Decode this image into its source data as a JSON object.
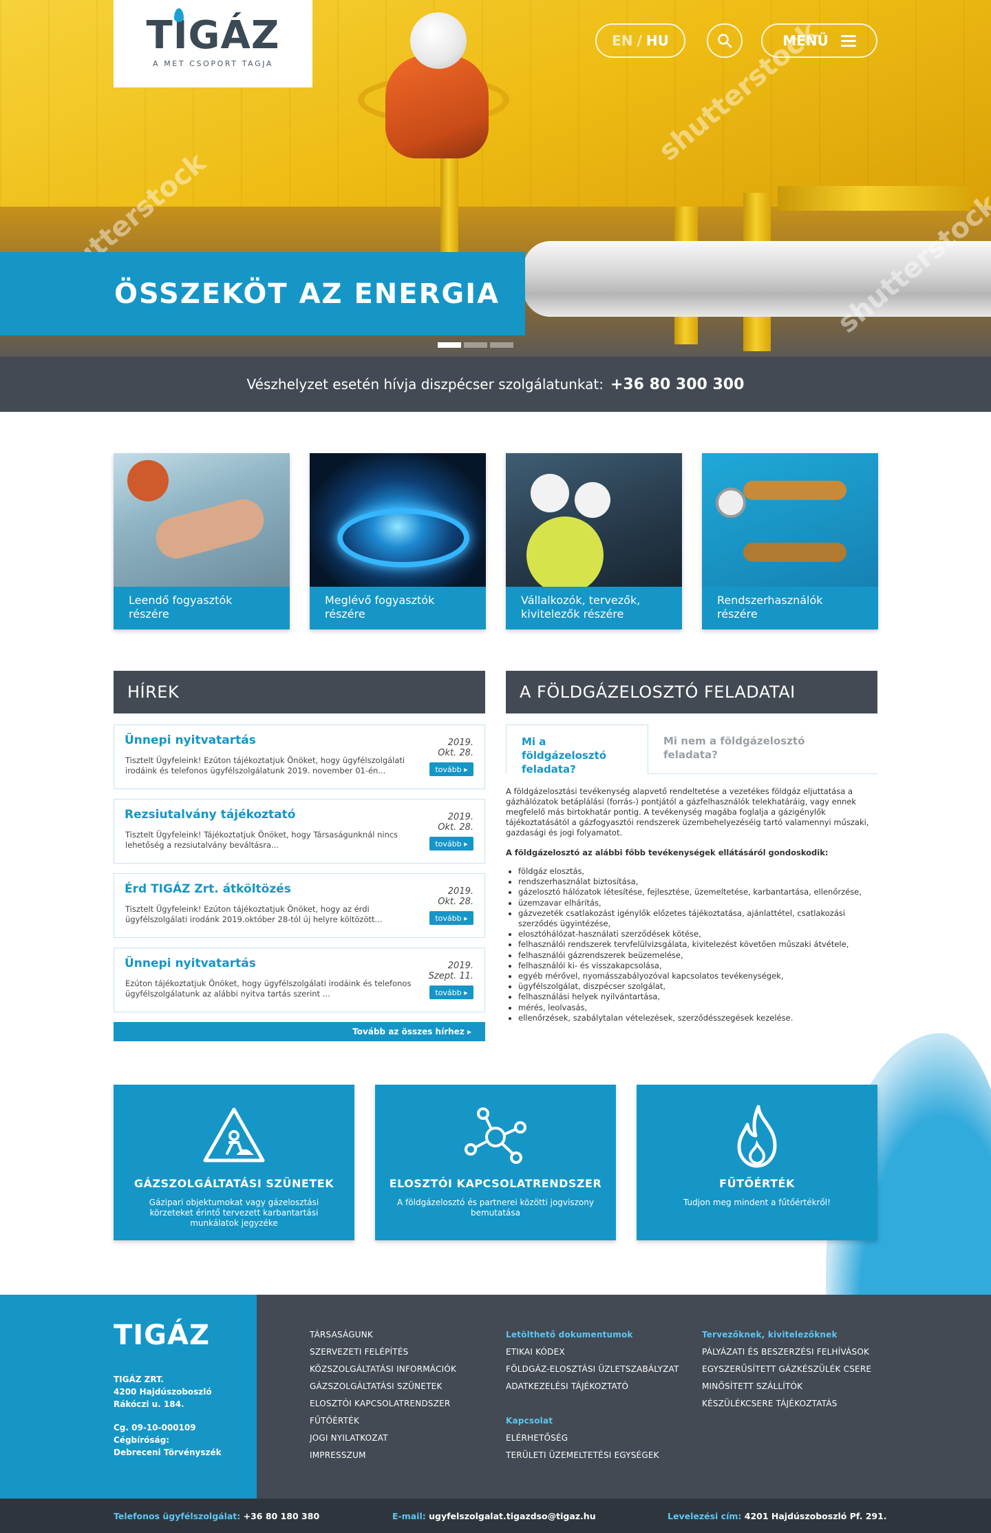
{
  "header": {
    "logo_text": "TIGÁZ",
    "logo_sub": "A MET CSOPORT TAGJA",
    "lang_en": "EN",
    "lang_sep": "/",
    "lang_hu": "HU",
    "menu_label": "MENÜ",
    "hero_title": "ÖSSZEKÖT AZ ENERGIA",
    "watermark": "shutterstock"
  },
  "emergency": {
    "text": "Vészhelyzet esetén hívja diszpécser szolgálatunkat:",
    "phone": "+36 80 300 300"
  },
  "cards": [
    {
      "label": "Leendő fogyasztók részére"
    },
    {
      "label": "Meglévő fogyasztók részére"
    },
    {
      "label": "Vállalkozók, tervezők, kivitelezők részére"
    },
    {
      "label": "Rendszerhasználók részére"
    }
  ],
  "news": {
    "heading": "HÍREK",
    "items": [
      {
        "title": "Ünnepi nyitvatartás",
        "text": "Tisztelt Ügyfeleink! Ezúton tájékoztatjuk Önöket, hogy ügyfélszolgálati irodáink és telefonos ügyfélszolgálatunk 2019. november 01-én...",
        "year": "2019.",
        "day": "Okt. 28.",
        "more": "tovább ▸"
      },
      {
        "title": "Rezsiutalvány tájékoztató",
        "text": "Tisztelt Ügyfeleink! Tájékoztatjuk Önöket, hogy Társaságunknál nincs lehetőség a rezsiutalvány beváltásra...",
        "year": "2019.",
        "day": "Okt. 28.",
        "more": "tovább ▸"
      },
      {
        "title": "Érd TIGÁZ Zrt. átköltözés",
        "text": "Tisztelt Ügyfeleink! Ezúton tájékoztatjuk Önöket, hogy az érdi ügyfélszolgálati irodánk 2019.október 28-tól új helyre költözött...",
        "year": "2019.",
        "day": "Okt. 28.",
        "more": "tovább ▸"
      },
      {
        "title": "Ünnepi nyitvatartás",
        "text": "Ezúton tájékoztatjuk Önöket, hogy ügyfélszolgálati irodáink és telefonos ügyfélszolgálatunk az alábbi nyitva tartás szerint ...",
        "year": "2019.",
        "day": "Szept. 11.",
        "more": "tovább ▸"
      }
    ],
    "all_link": "Tovább az összes hírhez ▸"
  },
  "tasks": {
    "heading": "A FÖLDGÁZELOSZTÓ FELADATAI",
    "tab_active": "Mi a földgázelosztó feladata?",
    "tab_inactive": "Mi nem a földgázelosztó feladata?",
    "intro": "A földgázelosztási tevékenység alapvető rendeltetése a vezetékes földgáz eljuttatása a gázhálózatok betáplálási (forrás-) pontjától a gázfelhasználók telekhatáráig, vagy ennek megfelelő más birtokhatár pontig. A tevékenység magába foglalja a gázigénylők tájékoztatásától a gázfogyasztói rendszerek üzembehelyezéséig tartó valamennyi műszaki, gazdasági és jogi folyamatot.",
    "list_title": "A földgázelosztó az alábbi főbb tevékenységek ellátásáról gondoskodik:",
    "list": [
      "földgáz elosztás,",
      "rendszerhasználat biztosítása,",
      "gázelosztó hálózatok létesítése, fejlesztése, üzemeltetése, karbantartása, ellenőrzése,",
      "üzemzavar elhárítás,",
      "gázvezeték csatlakozást igénylők előzetes tájékoztatása, ajánlattétel, csatlakozási szerződés ügyintézése,",
      "elosztóhálózat-használati szerződések kötése,",
      "felhasználói rendszerek tervfelülvizsgálata, kivitelezést követően műszaki átvétele,",
      "felhasználói gázrendszerek beüzemelése,",
      "felhasználói ki- és visszakapcsolása,",
      "egyéb mérővel, nyomásszabályozóval kapcsolatos tevékenységek,",
      "ügyfélszolgálat, diszpécser szolgálat,",
      "felhasználási helyek nyilvántartása,",
      "mérés, leolvasás,",
      "ellenőrzések, szabálytalan vételezések, szerződésszegések kezelése."
    ]
  },
  "services": [
    {
      "title": "GÁZSZOLGÁLTATÁSI SZÜNETEK",
      "text": "Gázipari objektumokat vagy gázelosztási körzeteket érintő tervezett karbantartási munkálatok jegyzéke",
      "icon": "roadwork-icon"
    },
    {
      "title": "ELOSZTÓI KAPCSOLATRENDSZER",
      "text": "A földgázelosztó és partnerei közötti jogviszony bemutatása",
      "icon": "network-icon"
    },
    {
      "title": "FŰTŐÉRTÉK",
      "text": "Tudjon meg mindent a fűtőértékről!",
      "icon": "flame-icon"
    }
  ],
  "footer": {
    "logo": "TIGÁZ",
    "company": "TIGÁZ ZRT.",
    "city": "4200 Hajdúszoboszló",
    "street": "Rákóczi u. 184.",
    "cg": "Cg. 09-10-000109",
    "court_label": "Cégbíróság:",
    "court": "Debreceni Törvényszék",
    "col1": [
      "TÁRSASÁGUNK",
      "SZERVEZETI FELÉPÍTÉS",
      "KÖZSZOLGÁLTATÁSI INFORMÁCIÓK",
      "GÁZSZOLGÁLTATÁSI SZÜNETEK",
      "ELOSZTÓI KAPCSOLATRENDSZER",
      "FŰTŐÉRTÉK",
      "JOGI NYILATKOZAT",
      "IMPRESSZUM"
    ],
    "col2_head": "Letölthető dokumentumok",
    "col2": [
      "ETIKAI KÓDEX",
      "FÖLDGÁZ-ELOSZTÁSI ÜZLETSZABÁLYZAT",
      "ADATKEZELÉSI TÁJÉKOZTATÓ"
    ],
    "col2b_head": "Kapcsolat",
    "col2b": [
      "ELÉRHETŐSÉG",
      "TERÜLETI ÜZEMELTETÉSI EGYSÉGEK"
    ],
    "col3_head": "Tervezőknek, kivitelezőknek",
    "col3": [
      "PÁLYÁZATI ÉS BESZERZÉSI FELHÍVÁSOK",
      "EGYSZERŰSÍTETT GÁZKÉSZÜLÉK CSERE",
      "MINŐSÍTETT SZÁLLÍTÓK",
      "KÉSZÜLÉKCSERE TÁJÉKOZTATÁS"
    ],
    "phone_label": "Telefonos ügyfélszolgálat:",
    "phone": "+36 80 180 380",
    "email_label": "E-mail:",
    "email": "ugyfelszolgalat.tigazdso@tigaz.hu",
    "post_label": "Levelezési cím:",
    "post": "4201 Hajdúszoboszló Pf. 291."
  }
}
